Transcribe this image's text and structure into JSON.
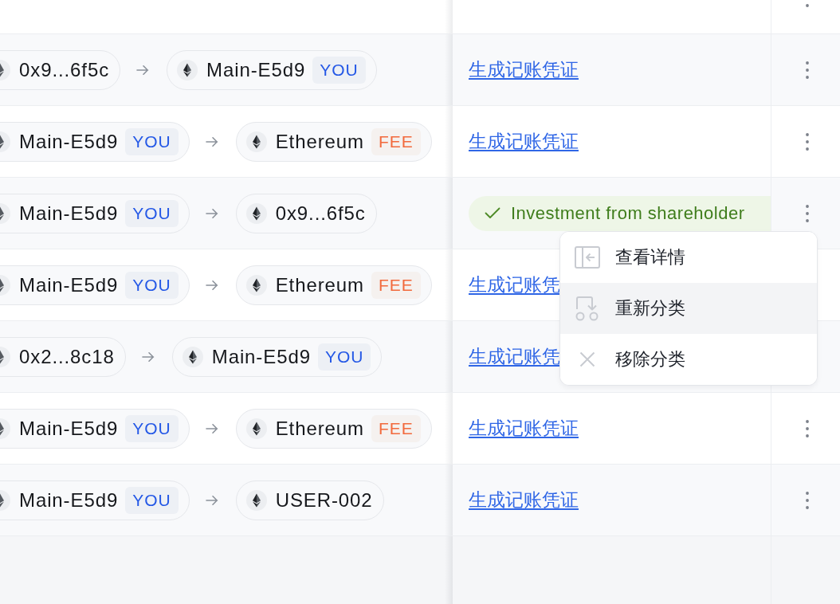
{
  "rows": [
    {},
    {
      "from": {
        "label": "0x9...6f5c"
      },
      "to": {
        "label": "Main-E5d9",
        "tag": {
          "text": "YOU",
          "kind": "self"
        }
      },
      "category": {
        "kind": "link",
        "text": "生成记账凭证"
      }
    },
    {
      "from": {
        "label": "Main-E5d9",
        "tag": {
          "text": "YOU",
          "kind": "self"
        }
      },
      "to": {
        "label": "Ethereum",
        "tag": {
          "text": "FEE",
          "kind": "fee"
        }
      },
      "category": {
        "kind": "link",
        "text": "生成记账凭证"
      }
    },
    {
      "from": {
        "label": "Main-E5d9",
        "tag": {
          "text": "YOU",
          "kind": "self"
        }
      },
      "to": {
        "label": "0x9...6f5c"
      },
      "category": {
        "kind": "tag",
        "text": "Investment from shareholder"
      },
      "menu": {
        "items": [
          {
            "label": "查看详情",
            "kind": "details",
            "selected": false
          },
          {
            "label": "重新分类",
            "kind": "reclassify",
            "selected": true
          },
          {
            "label": "移除分类",
            "kind": "remove",
            "selected": false
          }
        ]
      }
    },
    {
      "from": {
        "label": "Main-E5d9",
        "tag": {
          "text": "YOU",
          "kind": "self"
        }
      },
      "to": {
        "label": "Ethereum",
        "tag": {
          "text": "FEE",
          "kind": "fee"
        }
      },
      "category": {
        "kind": "link",
        "text": "生成记账凭"
      }
    },
    {
      "from": {
        "label": "0x2...8c18"
      },
      "to": {
        "label": "Main-E5d9",
        "tag": {
          "text": "YOU",
          "kind": "self"
        }
      },
      "category": {
        "kind": "link",
        "text": "生成记账凭"
      }
    },
    {
      "from": {
        "label": "Main-E5d9",
        "tag": {
          "text": "YOU",
          "kind": "self"
        }
      },
      "to": {
        "label": "Ethereum",
        "tag": {
          "text": "FEE",
          "kind": "fee"
        }
      },
      "category": {
        "kind": "link",
        "text": "生成记账凭证"
      }
    },
    {
      "from": {
        "label": "Main-E5d9",
        "tag": {
          "text": "YOU",
          "kind": "self"
        }
      },
      "to": {
        "label": "USER-002"
      },
      "category": {
        "kind": "link",
        "text": "生成记账凭证"
      }
    }
  ]
}
